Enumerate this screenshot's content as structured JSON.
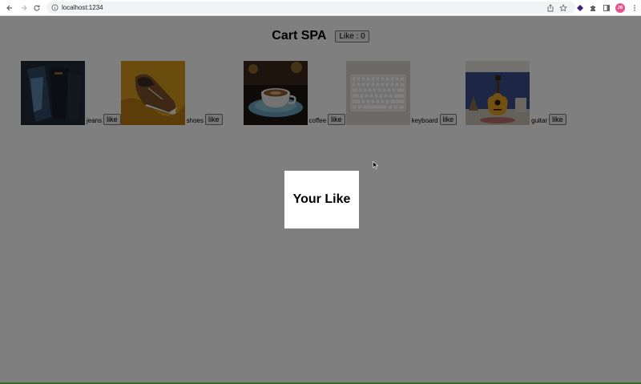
{
  "browser": {
    "url": "localhost:1234",
    "avatar_initials": "JB"
  },
  "header": {
    "title": "Cart SPA",
    "like_label": "Like : 0"
  },
  "products": [
    {
      "label": "jeans",
      "button": "like",
      "image": "jeans-photo"
    },
    {
      "label": "shoes",
      "button": "like",
      "image": "shoes-photo"
    },
    {
      "label": "coffee",
      "button": "like",
      "image": "coffee-photo"
    },
    {
      "label": "keyboard",
      "button": "like",
      "image": "keyboard-photo"
    },
    {
      "label": "guitar",
      "button": "like",
      "image": "guitar-photo"
    }
  ],
  "modal": {
    "title": "Your Like"
  },
  "colors": {
    "overlay": "rgba(0,0,0,0.5)",
    "avatar": "#e8538e",
    "bottom_strip": "#3b6e2a"
  }
}
